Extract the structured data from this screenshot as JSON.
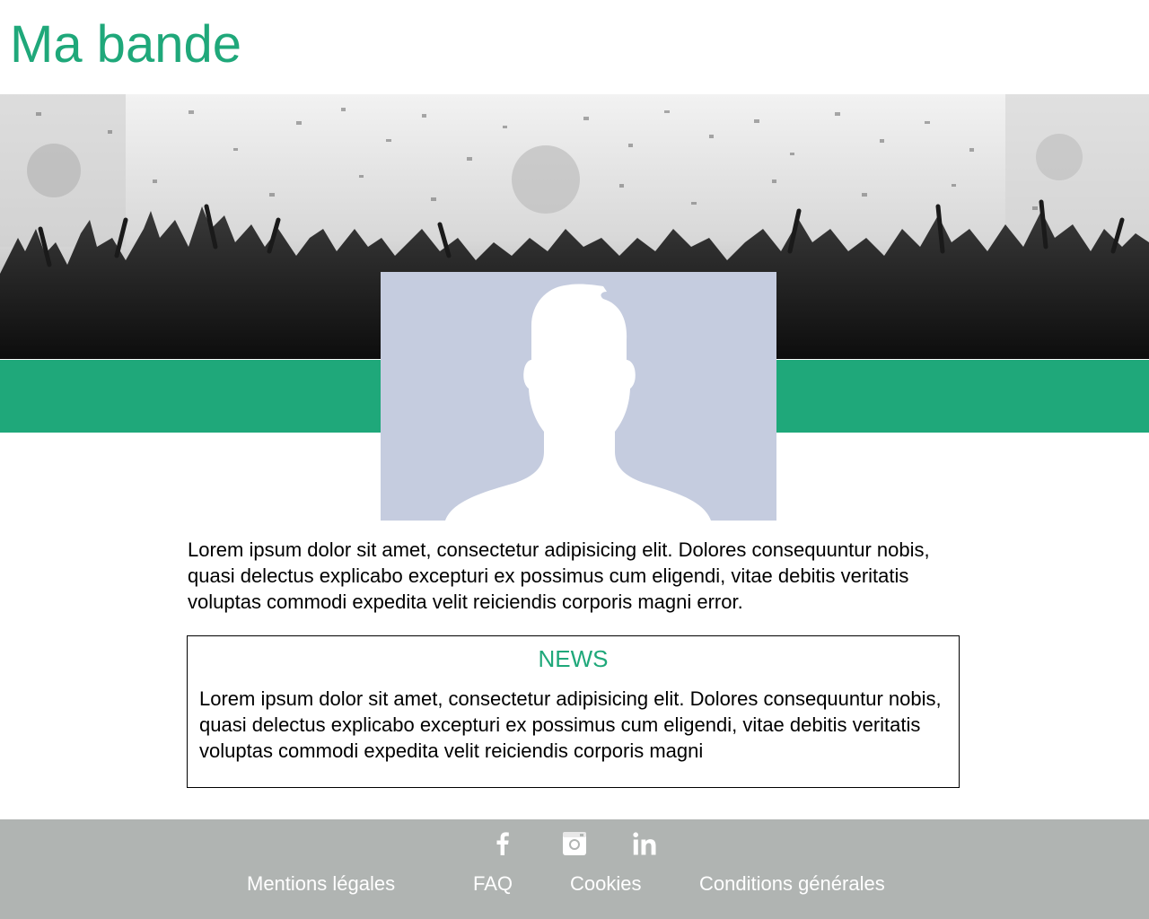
{
  "header": {
    "title": "Ma bande"
  },
  "hero": {
    "image": "concert-crowd-photo"
  },
  "profile": {
    "image": "default-avatar-silhouette"
  },
  "main": {
    "intro_text": "Lorem ipsum dolor sit amet, consectetur adipisicing elit. Dolores consequuntur nobis, quasi delectus explicabo excepturi ex possimus cum eligendi, vitae debitis veritatis voluptas commodi expedita velit reiciendis corporis magni error."
  },
  "news": {
    "title": "NEWS",
    "body": "Lorem ipsum dolor sit amet, consectetur adipisicing elit. Dolores consequun­tur nobis, quasi delectus explicabo excepturi ex possimus cum eligendi, vitae debitis veritatis voluptas commodi expedita velit reiciendis corporis magni"
  },
  "footer": {
    "social": [
      {
        "icon": "facebook-icon"
      },
      {
        "icon": "instagram-icon"
      },
      {
        "icon": "linkedin-icon"
      }
    ],
    "links": [
      {
        "label": "Mentions légales"
      },
      {
        "label": "FAQ"
      },
      {
        "label": "Cookies"
      },
      {
        "label": "Conditions générales"
      }
    ]
  },
  "colors": {
    "accent": "#1fa87a",
    "footer_bg": "#b0b4b2",
    "avatar_bg": "#c5ccdf",
    "text": "#000000",
    "footer_text": "#ffffff"
  }
}
